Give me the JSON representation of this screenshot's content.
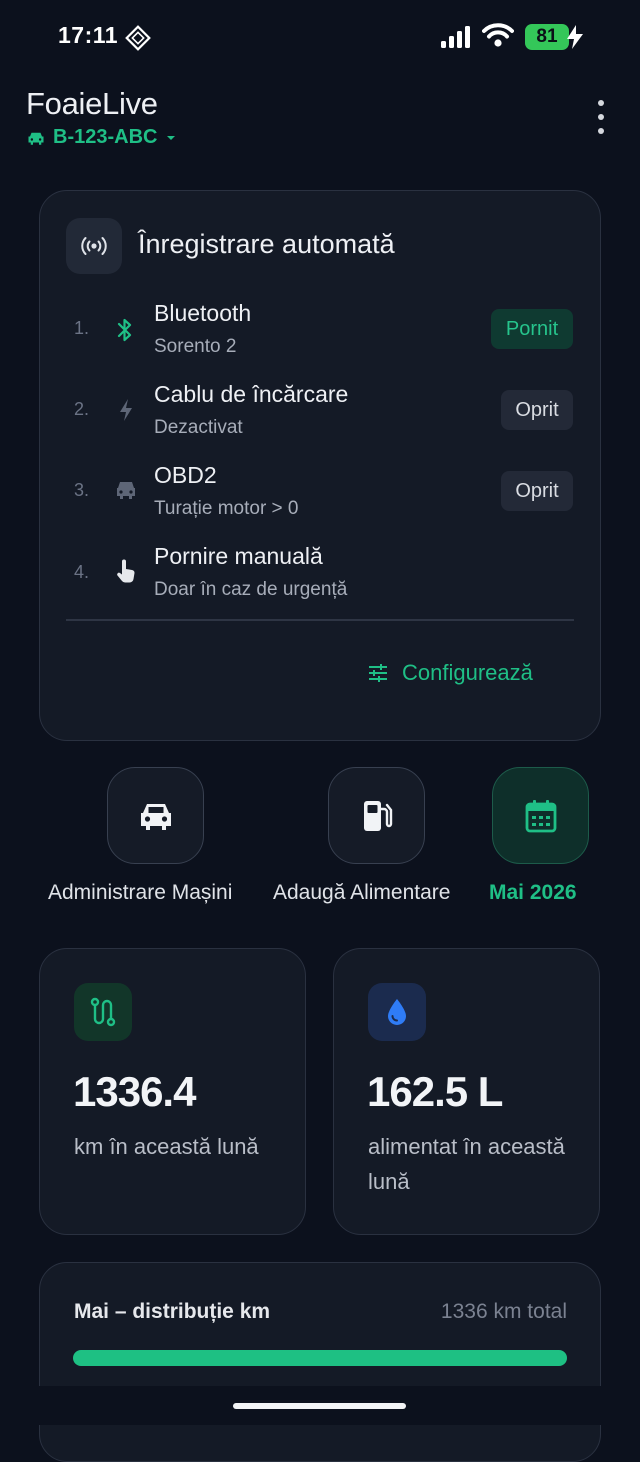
{
  "status_bar": {
    "time": "17:11",
    "battery": "81"
  },
  "header": {
    "app_title": "FoaieLive",
    "vehicle_plate": "B-123-ABC"
  },
  "auto_recording": {
    "title": "Înregistrare automată",
    "rows": [
      {
        "num": "1.",
        "title": "Bluetooth",
        "subtitle": "Sorento 2",
        "status": "Pornit",
        "icon": "bluetooth-icon"
      },
      {
        "num": "2.",
        "title": "Cablu de încărcare",
        "subtitle": "Dezactivat",
        "status": "Oprit",
        "icon": "bolt-icon"
      },
      {
        "num": "3.",
        "title": "OBD2",
        "subtitle": "Turație motor > 0",
        "status": "Oprit",
        "icon": "car-icon"
      },
      {
        "num": "4.",
        "title": "Pornire manuală",
        "subtitle": "Doar în caz de urgență",
        "status": "",
        "icon": "hand-pointer-icon"
      }
    ],
    "configure_label": "Configurează"
  },
  "quick_actions": [
    {
      "label": "Administrare Mașini",
      "icon": "car-icon"
    },
    {
      "label": "Adaugă Alimentare",
      "icon": "fuel-pump-icon"
    },
    {
      "label": "Mai 2026",
      "icon": "calendar-icon"
    }
  ],
  "stats": [
    {
      "value": "1336.4",
      "label": "km în această lună",
      "icon": "route-icon"
    },
    {
      "value": "162.5 L",
      "label": "alimentat în această lună",
      "icon": "droplet-icon"
    }
  ],
  "distribution": {
    "title": "Mai – distribuție km",
    "total": "1336 km total",
    "fill_fraction": 1.0
  },
  "colors": {
    "background": "#0c111d",
    "card": "#141a26",
    "accent": "#1fbf86",
    "blue_accent": "#2f7cf6"
  }
}
